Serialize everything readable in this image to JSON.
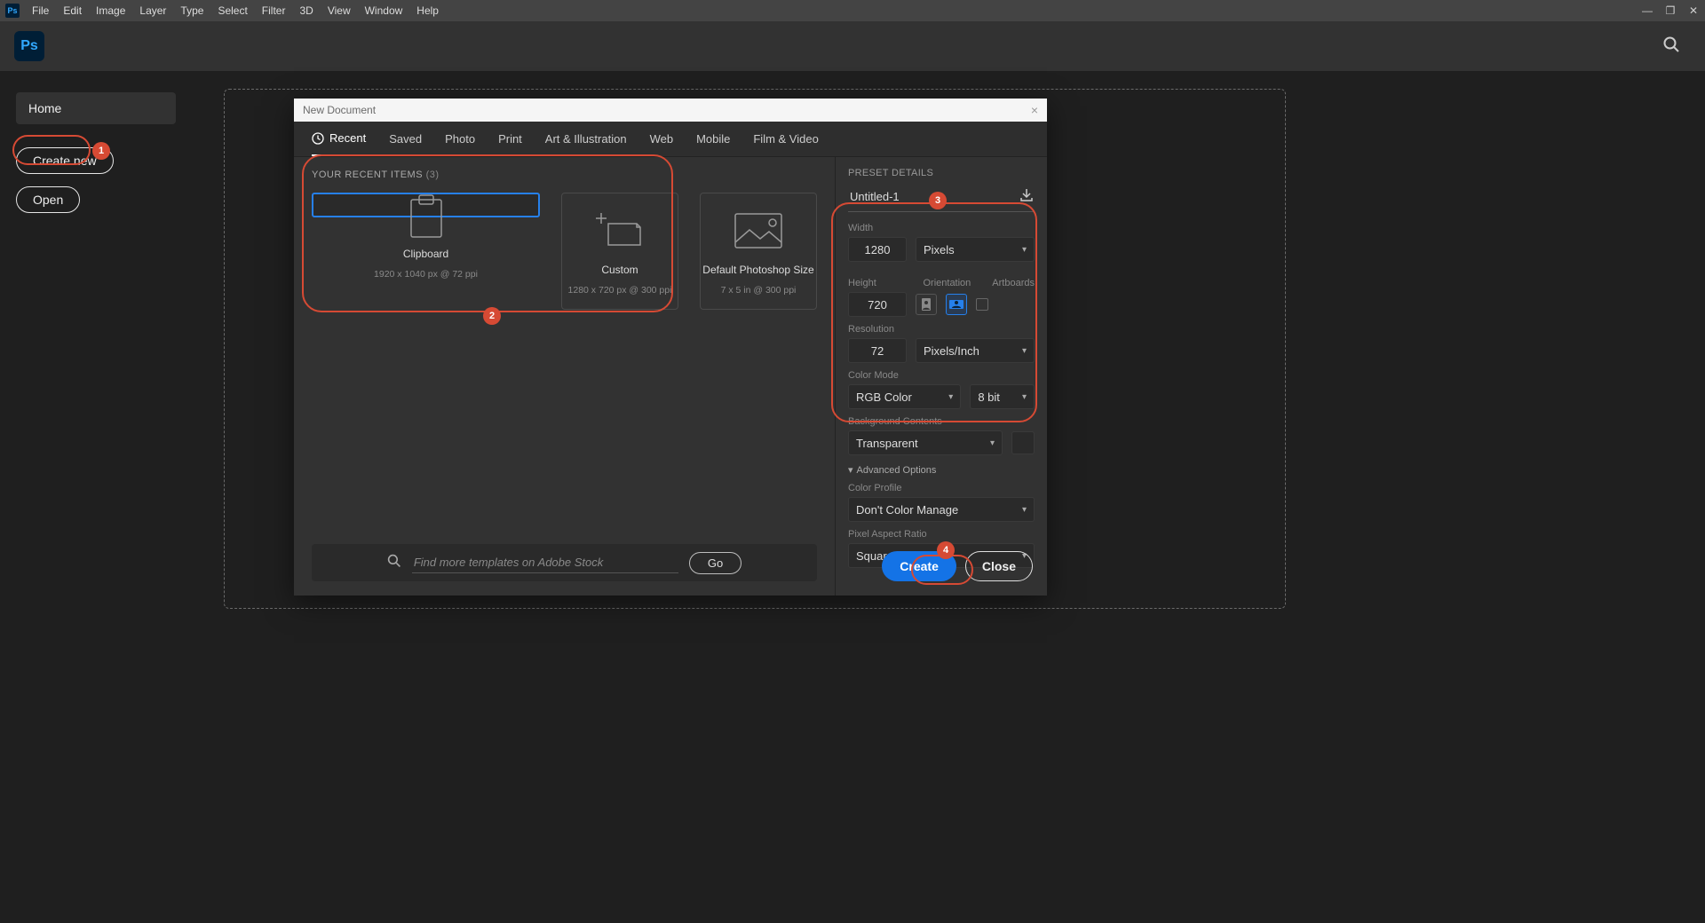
{
  "menubar": {
    "items": [
      "File",
      "Edit",
      "Image",
      "Layer",
      "Type",
      "Select",
      "Filter",
      "3D",
      "View",
      "Window",
      "Help"
    ]
  },
  "leftnav": {
    "home": "Home",
    "create_new": "Create new",
    "open": "Open"
  },
  "dialog": {
    "title": "New Document",
    "tabs": [
      "Recent",
      "Saved",
      "Photo",
      "Print",
      "Art & Illustration",
      "Web",
      "Mobile",
      "Film & Video"
    ],
    "recent_header": "YOUR RECENT ITEMS",
    "recent_count": "(3)",
    "presets": [
      {
        "name": "Clipboard",
        "sub": "1920 x 1040 px @ 72 ppi"
      },
      {
        "name": "Custom",
        "sub": "1280 x 720 px @ 300 ppi"
      },
      {
        "name": "Default Photoshop Size",
        "sub": "7 x 5 in @ 300 ppi"
      }
    ],
    "stock_placeholder": "Find more templates on Adobe Stock",
    "go": "Go"
  },
  "details": {
    "header": "PRESET DETAILS",
    "name": "Untitled-1",
    "width_label": "Width",
    "width": "1280",
    "width_unit": "Pixels",
    "height_label": "Height",
    "height": "720",
    "orientation_label": "Orientation",
    "artboards_label": "Artboards",
    "resolution_label": "Resolution",
    "resolution": "72",
    "resolution_unit": "Pixels/Inch",
    "color_mode_label": "Color Mode",
    "color_mode": "RGB Color",
    "bit_depth": "8 bit",
    "bg_label": "Background Contents",
    "bg": "Transparent",
    "advanced": "Advanced Options",
    "profile_label": "Color Profile",
    "profile": "Don't Color Manage",
    "aspect_label": "Pixel Aspect Ratio",
    "aspect": "Square Pixels",
    "create": "Create",
    "close": "Close"
  },
  "annotations": {
    "1": "1",
    "2": "2",
    "3": "3",
    "4": "4"
  }
}
